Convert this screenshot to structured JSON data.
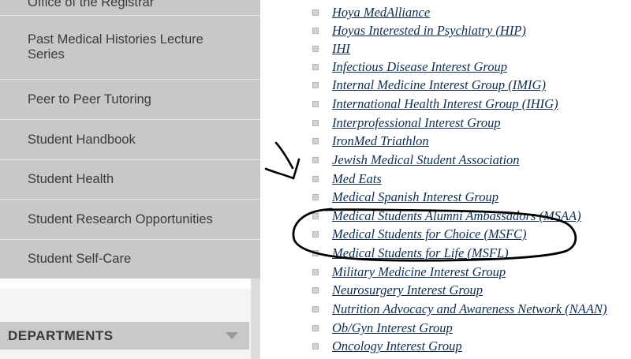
{
  "sidebar": {
    "items": [
      {
        "label": "Office of the Registrar"
      },
      {
        "label": "Past Medical Histories Lecture Series"
      },
      {
        "label": "Peer to Peer Tutoring"
      },
      {
        "label": "Student Handbook"
      },
      {
        "label": "Student Health"
      },
      {
        "label": "Student Research Opportunities"
      },
      {
        "label": "Student Self-Care"
      }
    ]
  },
  "departments": {
    "label": "DEPARTMENTS",
    "caret_icon": "caret-down-icon"
  },
  "groups": {
    "items": [
      {
        "label": "Hoya MedAlliance"
      },
      {
        "label": "Hoyas Interested in Psychiatry (HIP)"
      },
      {
        "label": "IHI"
      },
      {
        "label": "Infectious Disease Interest Group"
      },
      {
        "label": "Internal Medicine Interest Group (IMIG)"
      },
      {
        "label": "International Health Interest Group (IHIG)"
      },
      {
        "label": "Interprofessional Interest Group"
      },
      {
        "label": "IronMed Triathlon"
      },
      {
        "label": "Jewish Medical Student Association"
      },
      {
        "label": "Med Eats"
      },
      {
        "label": "Medical Spanish Interest Group"
      },
      {
        "label": "Medical Students Alumni Ambassadors (MSAA)"
      },
      {
        "label": "Medical Students for Choice (MSFC)"
      },
      {
        "label": "Medical Students for Life (MSFL)"
      },
      {
        "label": "Military Medicine Interest Group"
      },
      {
        "label": "Neurosurgery Interest Group"
      },
      {
        "label": "Nutrition Advocacy and Awareness Network (NAAN)"
      },
      {
        "label": "Ob/Gyn Interest Group"
      },
      {
        "label": "Oncology Interest Group"
      }
    ]
  },
  "annotations": {
    "arrow_icon": "hand-drawn-arrow-icon",
    "circle_icon": "hand-drawn-circle-icon",
    "ink_color": "#000000"
  },
  "colors": {
    "sidebar_bg": "#c8c8c8",
    "link": "#0f2d50",
    "dept_bar": "#c9c9c9"
  }
}
